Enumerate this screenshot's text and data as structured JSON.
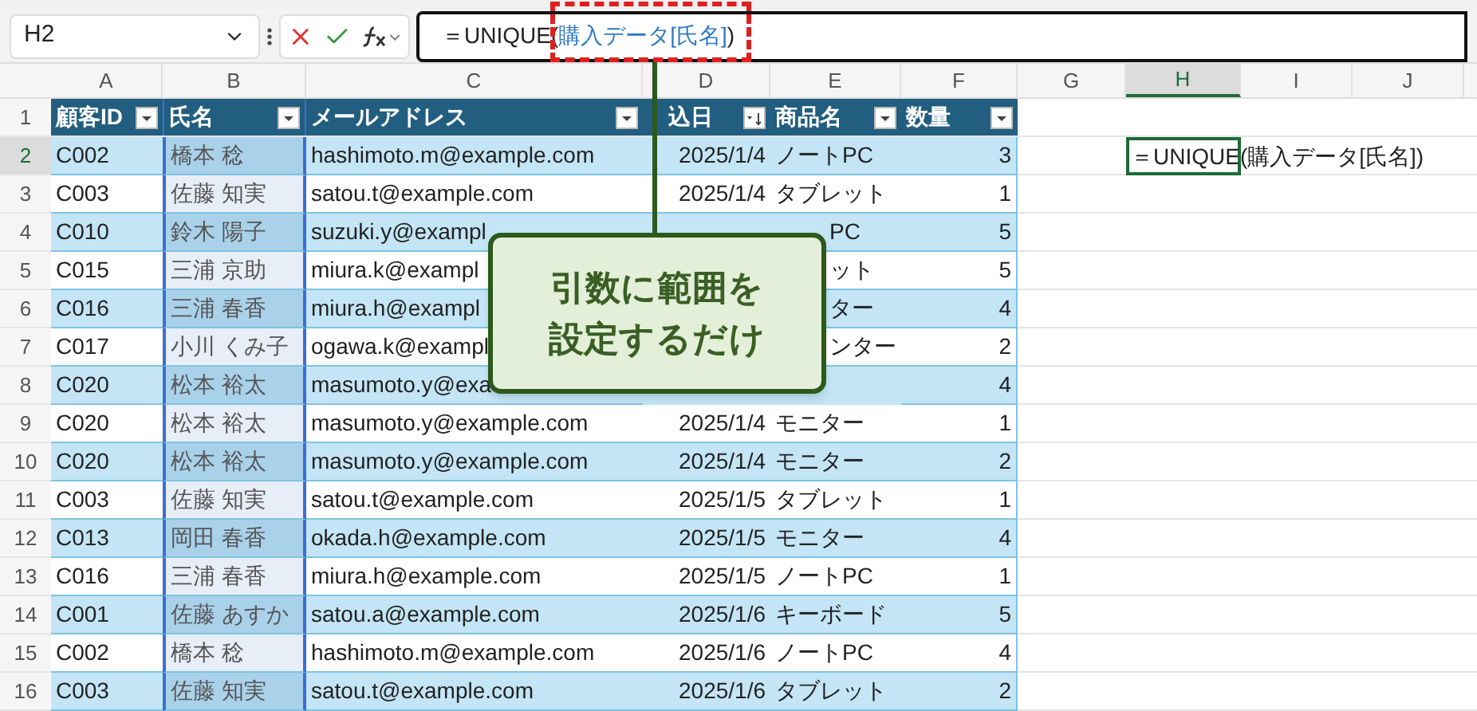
{
  "name_box": {
    "value": "H2"
  },
  "formula_bar": {
    "function": "＝UNIQUE(",
    "reference": "購入データ[氏名]",
    "close": ")"
  },
  "column_headers": [
    {
      "label": "A",
      "selected": false
    },
    {
      "label": "B",
      "selected": false
    },
    {
      "label": "C",
      "selected": false
    },
    {
      "label": "D",
      "selected": false
    },
    {
      "label": "E",
      "selected": false
    },
    {
      "label": "F",
      "selected": false
    },
    {
      "label": "G",
      "selected": false
    },
    {
      "label": "H",
      "selected": true
    },
    {
      "label": "I",
      "selected": false
    },
    {
      "label": "J",
      "selected": false
    }
  ],
  "table": {
    "columns": [
      {
        "label": "顧客ID",
        "sorted": false,
        "referenced": false
      },
      {
        "label": "氏名",
        "sorted": false,
        "referenced": true
      },
      {
        "label": "メールアドレス",
        "sorted": false,
        "referenced": false
      },
      {
        "label": "込日",
        "sorted": true,
        "referenced": false
      },
      {
        "label": "商品名",
        "sorted": false,
        "referenced": false
      },
      {
        "label": "数量",
        "sorted": false,
        "referenced": false
      }
    ],
    "rows": [
      {
        "row": "2",
        "selected": true,
        "id": "C002",
        "name": "橋本 稔",
        "email": "hashimoto.m@example.com",
        "date": "2025/1/4",
        "product": "ノートPC",
        "qty": "3"
      },
      {
        "row": "3",
        "selected": false,
        "id": "C003",
        "name": "佐藤 知実",
        "email": "satou.t@example.com",
        "date": "2025/1/4",
        "product": "タブレット",
        "qty": "1"
      },
      {
        "row": "4",
        "selected": false,
        "id": "C010",
        "name": "鈴木 陽子",
        "email": "suzuki.y@exampl",
        "product": "PC",
        "qty": "5"
      },
      {
        "row": "5",
        "selected": false,
        "id": "C015",
        "name": "三浦 京助",
        "email": "miura.k@exampl",
        "product": "ット",
        "qty": "5"
      },
      {
        "row": "6",
        "selected": false,
        "id": "C016",
        "name": "三浦 春香",
        "email": "miura.h@exampl",
        "product": "ター",
        "qty": "4"
      },
      {
        "row": "7",
        "selected": false,
        "id": "C017",
        "name": "小川 くみ子",
        "email": "ogawa.k@exampl",
        "product": "ンター",
        "qty": "2"
      },
      {
        "row": "8",
        "selected": false,
        "id": "C020",
        "name": "松本 裕太",
        "email": "masumoto.y@exa",
        "qty": "4"
      },
      {
        "row": "9",
        "selected": false,
        "id": "C020",
        "name": "松本 裕太",
        "email": "masumoto.y@example.com",
        "date": "2025/1/4",
        "product": "モニター",
        "qty": "1"
      },
      {
        "row": "10",
        "selected": false,
        "id": "C020",
        "name": "松本 裕太",
        "email": "masumoto.y@example.com",
        "date": "2025/1/4",
        "product": "モニター",
        "qty": "2"
      },
      {
        "row": "11",
        "selected": false,
        "id": "C003",
        "name": "佐藤 知実",
        "email": "satou.t@example.com",
        "date": "2025/1/5",
        "product": "タブレット",
        "qty": "1"
      },
      {
        "row": "12",
        "selected": false,
        "id": "C013",
        "name": "岡田 春香",
        "email": "okada.h@example.com",
        "date": "2025/1/5",
        "product": "モニター",
        "qty": "4"
      },
      {
        "row": "13",
        "selected": false,
        "id": "C016",
        "name": "三浦 春香",
        "email": "miura.h@example.com",
        "date": "2025/1/5",
        "product": "ノートPC",
        "qty": "1"
      },
      {
        "row": "14",
        "selected": false,
        "id": "C001",
        "name": "佐藤 あすか",
        "email": "satou.a@example.com",
        "date": "2025/1/6",
        "product": "キーボード",
        "qty": "5"
      },
      {
        "row": "15",
        "selected": false,
        "id": "C002",
        "name": "橋本 稔",
        "email": "hashimoto.m@example.com",
        "date": "2025/1/6",
        "product": "ノートPC",
        "qty": "4"
      },
      {
        "row": "16",
        "selected": false,
        "id": "C003",
        "name": "佐藤 知実",
        "email": "satou.t@example.com",
        "date": "2025/1/6",
        "product": "タブレット",
        "qty": "2"
      }
    ]
  },
  "header_row": "1",
  "active_cell": {
    "value": "＝UNIQUE(購入データ[氏名])"
  },
  "callout": {
    "lines": [
      "引数に範囲を",
      "設定するだけ"
    ]
  }
}
